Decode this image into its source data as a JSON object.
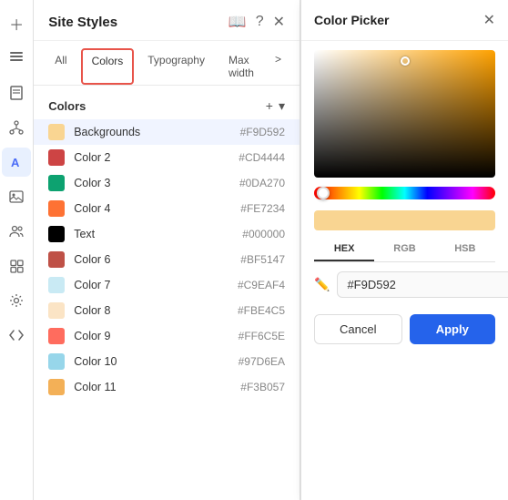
{
  "panel": {
    "title": "Site Styles",
    "tabs": [
      {
        "label": "All",
        "id": "all",
        "active": false
      },
      {
        "label": "Colors",
        "id": "colors",
        "active": true
      },
      {
        "label": "Typography",
        "id": "typography",
        "active": false
      },
      {
        "label": "Max width",
        "id": "maxwidth",
        "active": false
      }
    ],
    "more_label": ">",
    "section_title": "Colors",
    "add_label": "+",
    "options_label": "▾"
  },
  "colors": [
    {
      "name": "Backgrounds",
      "hex": "#F9D592",
      "swatch": "#F9D592",
      "selected": true
    },
    {
      "name": "Color 2",
      "hex": "#CD4444",
      "swatch": "#CD4444"
    },
    {
      "name": "Color 3",
      "hex": "#0DA270",
      "swatch": "#0DA270"
    },
    {
      "name": "Color 4",
      "hex": "#FE7234",
      "swatch": "#FE7234"
    },
    {
      "name": "Text",
      "hex": "#000000",
      "swatch": "#000000"
    },
    {
      "name": "Color 6",
      "hex": "#BF5147",
      "swatch": "#BF5147"
    },
    {
      "name": "Color 7",
      "hex": "#C9EAF4",
      "swatch": "#C9EAF4"
    },
    {
      "name": "Color 8",
      "hex": "#FBE4C5",
      "swatch": "#FBE4C5"
    },
    {
      "name": "Color 9",
      "hex": "#FF6C5E",
      "swatch": "#FF6C5E"
    },
    {
      "name": "Color 10",
      "hex": "#97D6EA",
      "swatch": "#97D6EA"
    },
    {
      "name": "Color 11",
      "hex": "#F3B057",
      "swatch": "#F3B057"
    }
  ],
  "color_picker": {
    "title": "Color Picker",
    "tabs": [
      "HEX",
      "RGB",
      "HSB"
    ],
    "active_tab": "HEX",
    "hex_value": "#F9D592",
    "cancel_label": "Cancel",
    "apply_label": "Apply"
  },
  "sidebar_icons": [
    "plus",
    "layers",
    "page",
    "tree",
    "text",
    "image",
    "people",
    "grid",
    "settings",
    "code"
  ]
}
